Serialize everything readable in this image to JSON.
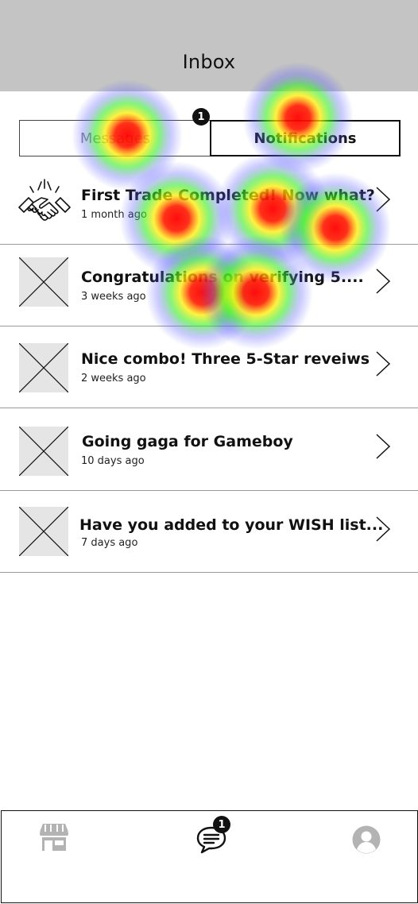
{
  "header": {
    "title": "Inbox"
  },
  "tabs": {
    "messages_label": "Messages",
    "notifications_label": "Notifications",
    "badge_count": "1"
  },
  "notifications": [
    {
      "title": "First Trade Completed! Now what?",
      "time": "1 month ago",
      "icon": "handshake-icon"
    },
    {
      "title": "Congratulations on verifying 5....",
      "time": "3 weeks ago",
      "icon": "image-placeholder-icon"
    },
    {
      "title": "Nice combo! Three 5-Star reveiws",
      "time": "2 weeks ago",
      "icon": "image-placeholder-icon"
    },
    {
      "title": "Going gaga for Gameboy",
      "time": "10 days ago",
      "icon": "image-placeholder-icon"
    },
    {
      "title": "Have you added to your WISH list...",
      "time": "7 days ago",
      "icon": "image-placeholder-icon"
    }
  ],
  "bottom_nav": {
    "items": [
      "store-icon",
      "chat-icon",
      "profile-icon"
    ],
    "chat_badge_count": "1"
  },
  "colors": {
    "header_bg": "#c4c4c4",
    "placeholder_bg": "#e5e5e5",
    "accent": "#111111"
  }
}
